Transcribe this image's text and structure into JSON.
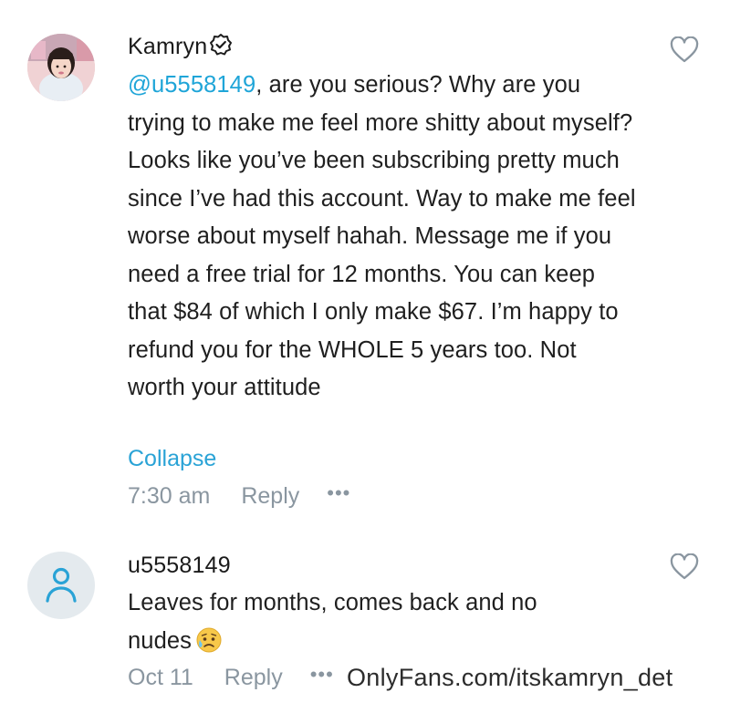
{
  "comments": [
    {
      "author": "Kamryn",
      "mention": "@u5558149",
      "text": ", are you serious? Why are you trying to make me feel more shitty about myself? Looks like you’ve been subscribing pretty much since I’ve had this account. Way to make me feel worse about myself hahah. Message me if you need a free trial for 12 months. You can keep that $84 of which I only make $67. I’m happy to refund you for the WHOLE 5 years too. Not worth your attitude",
      "collapse_label": "Collapse",
      "time": "7:30 am",
      "reply_label": "Reply",
      "more_label": "•••"
    },
    {
      "author": "u5558149",
      "text": "Leaves for months, comes back and no nudes",
      "time": "Oct 11",
      "reply_label": "Reply",
      "more_label": "•••"
    }
  ],
  "watermark": "OnlyFans.com/itskamryn_det",
  "colors": {
    "accent": "#1fa5d8",
    "meta": "#8a96a0",
    "text": "#1f1f1f"
  },
  "icons": [
    "verified-badge-icon",
    "heart-icon",
    "user-icon",
    "sad-sweat-emoji-icon",
    "more-dots-icon"
  ]
}
